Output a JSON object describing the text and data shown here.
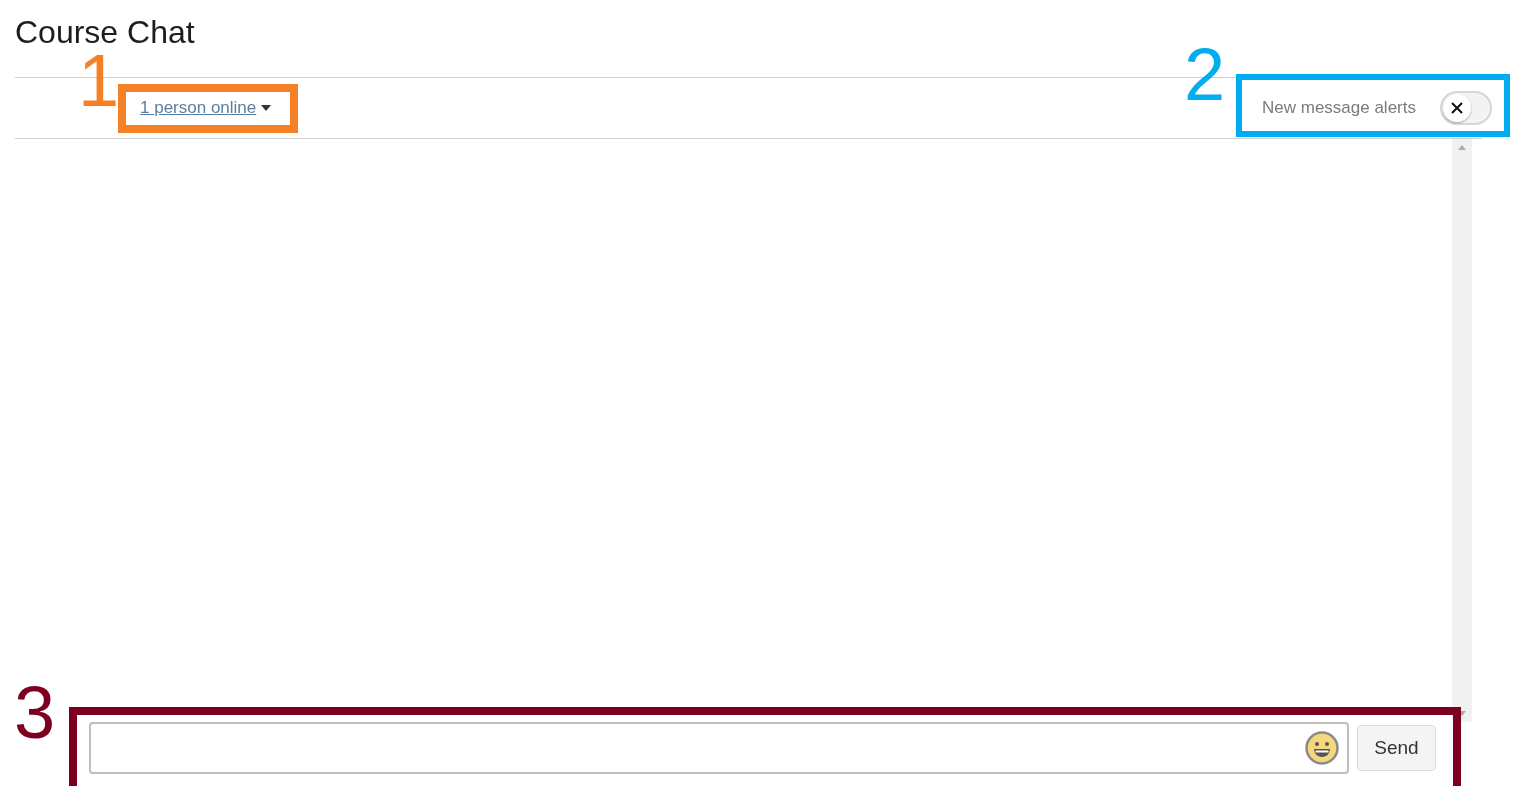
{
  "title": "Course Chat",
  "toolbar": {
    "online_link": "1 person online",
    "alerts": {
      "label": "New message alerts",
      "on": false
    }
  },
  "composer": {
    "send_button": "Send"
  },
  "annotations": [
    {
      "label": "1",
      "color": "#f58025"
    },
    {
      "label": "2",
      "color": "#00aeef"
    },
    {
      "label": "3",
      "color": "#7d0020"
    }
  ]
}
